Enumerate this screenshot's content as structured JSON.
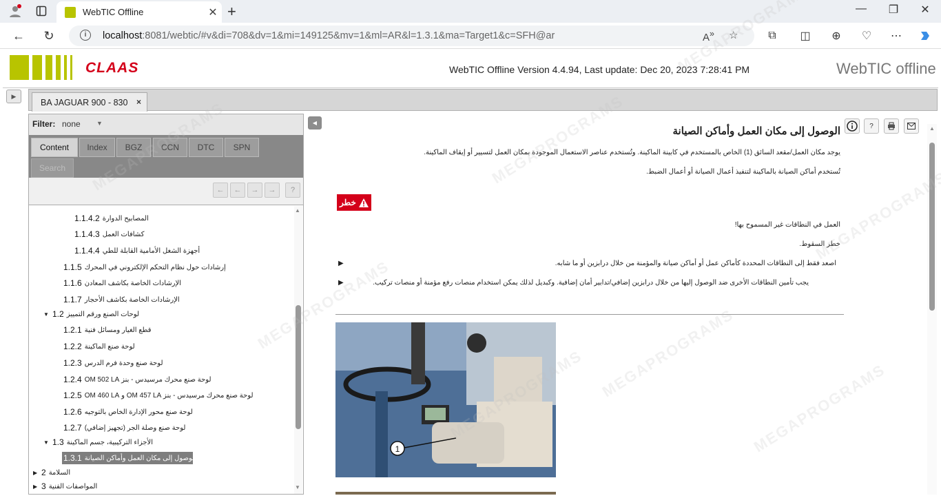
{
  "browser": {
    "tab_title": "WebTIC Offline",
    "url_host": "localhost",
    "url_rest": ":8081/webtic/#v&di=708&dv=1&mi=149125&mv=1&ml=AR&l=1.3.1&ma=Target1&c=SFH@ar",
    "read_aloud": "A",
    "read_aloud_super": "»"
  },
  "app": {
    "logo_text": "CLAAS",
    "version_text": "WebTIC Offline Version 4.4.94, Last update: Dec 20, 2023 7:28:41 PM",
    "brand": "WebTIC offline",
    "brand_color": "#b8c400",
    "accent_color": "#d4001a"
  },
  "doc_tab": {
    "label": "BA JAGUAR 900 - 830",
    "close": "×"
  },
  "left_panel": {
    "filter_label": "Filter:",
    "filter_value": "none",
    "tabs": [
      "Content",
      "Index",
      "BGZ",
      "CCN",
      "DTC",
      "SPN",
      "Search"
    ],
    "toolbar": [
      "←",
      "←",
      "→",
      "→",
      "?"
    ],
    "tree": [
      {
        "num": "1.1.4.2",
        "text": "المصابيح الدوارة"
      },
      {
        "num": "1.1.4.3",
        "text": "كشافات العمل"
      },
      {
        "num": "1.1.4.4",
        "text": "أجهزة الشغل الأمامية القابلة للطي"
      },
      {
        "num": "1.1.5",
        "text": "إرشادات حول نظام التحكم الإلكتروني في المحرك"
      },
      {
        "num": "1.1.6",
        "text": "الإرشادات الخاصة بكاشف المعادن"
      },
      {
        "num": "1.1.7",
        "text": "الإرشادات الخاصة بكاشف الأحجار"
      },
      {
        "num": "1.2",
        "text": "لوحات الصنع ورقم التمييز"
      },
      {
        "num": "1.2.1",
        "text": "قطع الغيار ومسائل فنية"
      },
      {
        "num": "1.2.2",
        "text": "لوحة صنع الماكينة"
      },
      {
        "num": "1.2.3",
        "text": "لوحة صنع وحدة فرم الدرس"
      },
      {
        "num": "1.2.4",
        "text": "لوحة صنع محرك مرسيدس - بنز OM 502 LA"
      },
      {
        "num": "1.2.5",
        "text": "لوحة صنع محرك مرسيدس - بنز OM 457 LA و OM 460 LA"
      },
      {
        "num": "1.2.6",
        "text": "لوحة صنع محور الإدارة الخاص بالتوجيه"
      },
      {
        "num": "1.2.7",
        "text": "لوحة صنع وصلة الجر (تجهيز إضافي)"
      },
      {
        "num": "1.3",
        "text": "الأجزاء التركيبية، جسم الماكينة"
      },
      {
        "num": "1.3.1",
        "text": "الوصول إلى مكان العمل وأماكن الصيانة"
      },
      {
        "num": "2",
        "text": "السلامة"
      },
      {
        "num": "3",
        "text": "المواصفات الفنية"
      }
    ]
  },
  "content": {
    "title": "الوصول إلى مكان العمل وأماكن الصيانة",
    "para1": "يوجد مكان العمل/مقعد السائق (1) الخاص بالمستخدم في كابينة الماكينة. وتُستخدم عناصر الاستعمال الموجودة بمكان العمل لتسيير أو إيقاف الماكينة.",
    "para2": "تُستخدم أماكن الصيانة بالماكينة لتنفيذ أعمال الصيانة أو أعمال الضبط.",
    "danger_label": "خطر",
    "warning_heading": "العمل في النطاقات غير المسموح بها!",
    "warning_sub": "خطر السقوط.",
    "bullet1": "اصعد فقط إلى النطاقات المحددة كأماكن عمل أو أماكن صيانة والمؤمنة من خلال درابزين أو ما شابه.",
    "bullet2": "يجب تأمين النطاقات الأخرى ضد الوصول إليها من خلال درابزين إضافي/تدابير أمان إضافية. وكبديل لذلك يمكن استخدام منصات رفع مؤمنة أو منصات تركيب.",
    "callout": "1",
    "icons": [
      "info-icon",
      "help-icon",
      "print-icon",
      "mail-icon"
    ]
  },
  "watermark": "MEGAPROGRAMS"
}
